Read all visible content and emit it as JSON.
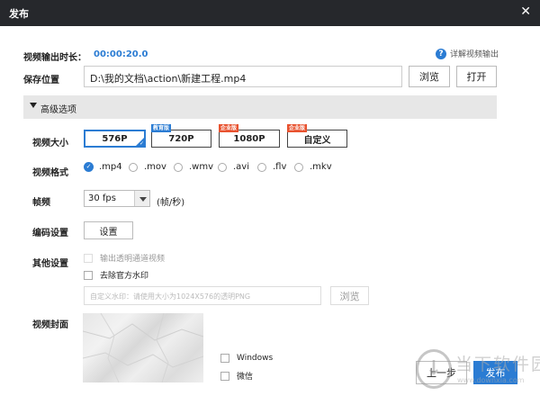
{
  "window": {
    "title": "发布"
  },
  "header": {
    "duration_label": "视频输出时长：",
    "duration_value": "00:00:20.0",
    "help_link": "详解视频输出"
  },
  "save": {
    "label": "保存位置",
    "path": "D:\\我的文档\\action\\新建工程.mp4",
    "browse": "浏览",
    "open": "打开"
  },
  "advanced": {
    "label": "高级选项"
  },
  "resolution": {
    "label": "视频大小",
    "options": [
      {
        "label": "576P",
        "selected": true,
        "tag": ""
      },
      {
        "label": "720P",
        "selected": false,
        "tag": "教育版",
        "tag_color": "#2b7cd3"
      },
      {
        "label": "1080P",
        "selected": false,
        "tag": "企业版",
        "tag_color": "#e8522f"
      },
      {
        "label": "自定义",
        "selected": false,
        "tag": "企业版",
        "tag_color": "#e8522f"
      }
    ]
  },
  "format": {
    "label": "视频格式",
    "options": [
      ".mp4",
      ".mov",
      ".wmv",
      ".avi",
      ".flv",
      ".mkv"
    ],
    "selected": ".mp4"
  },
  "framerate": {
    "label": "帧频",
    "value": "30 fps",
    "unit": "(帧/秒)"
  },
  "encoding": {
    "label": "编码设置",
    "button": "设置"
  },
  "other": {
    "label": "其他设置",
    "transparent_video": "输出透明通道视频",
    "remove_watermark": "去除官方水印",
    "watermark_placeholder": "自定义水印：请使用大小为1024X576的透明PNG",
    "browse": "浏览"
  },
  "cover": {
    "label": "视频封面",
    "options": [
      "Windows",
      "微信"
    ]
  },
  "footer": {
    "prev": "上一步",
    "publish": "发布"
  },
  "overlay": {
    "brand_text": "当下软件园",
    "brand_url": "www.downxia.com"
  },
  "colors": {
    "accent": "#2b7cd3",
    "titlebar": "#26282c",
    "section_bg": "#e7e7e7"
  }
}
